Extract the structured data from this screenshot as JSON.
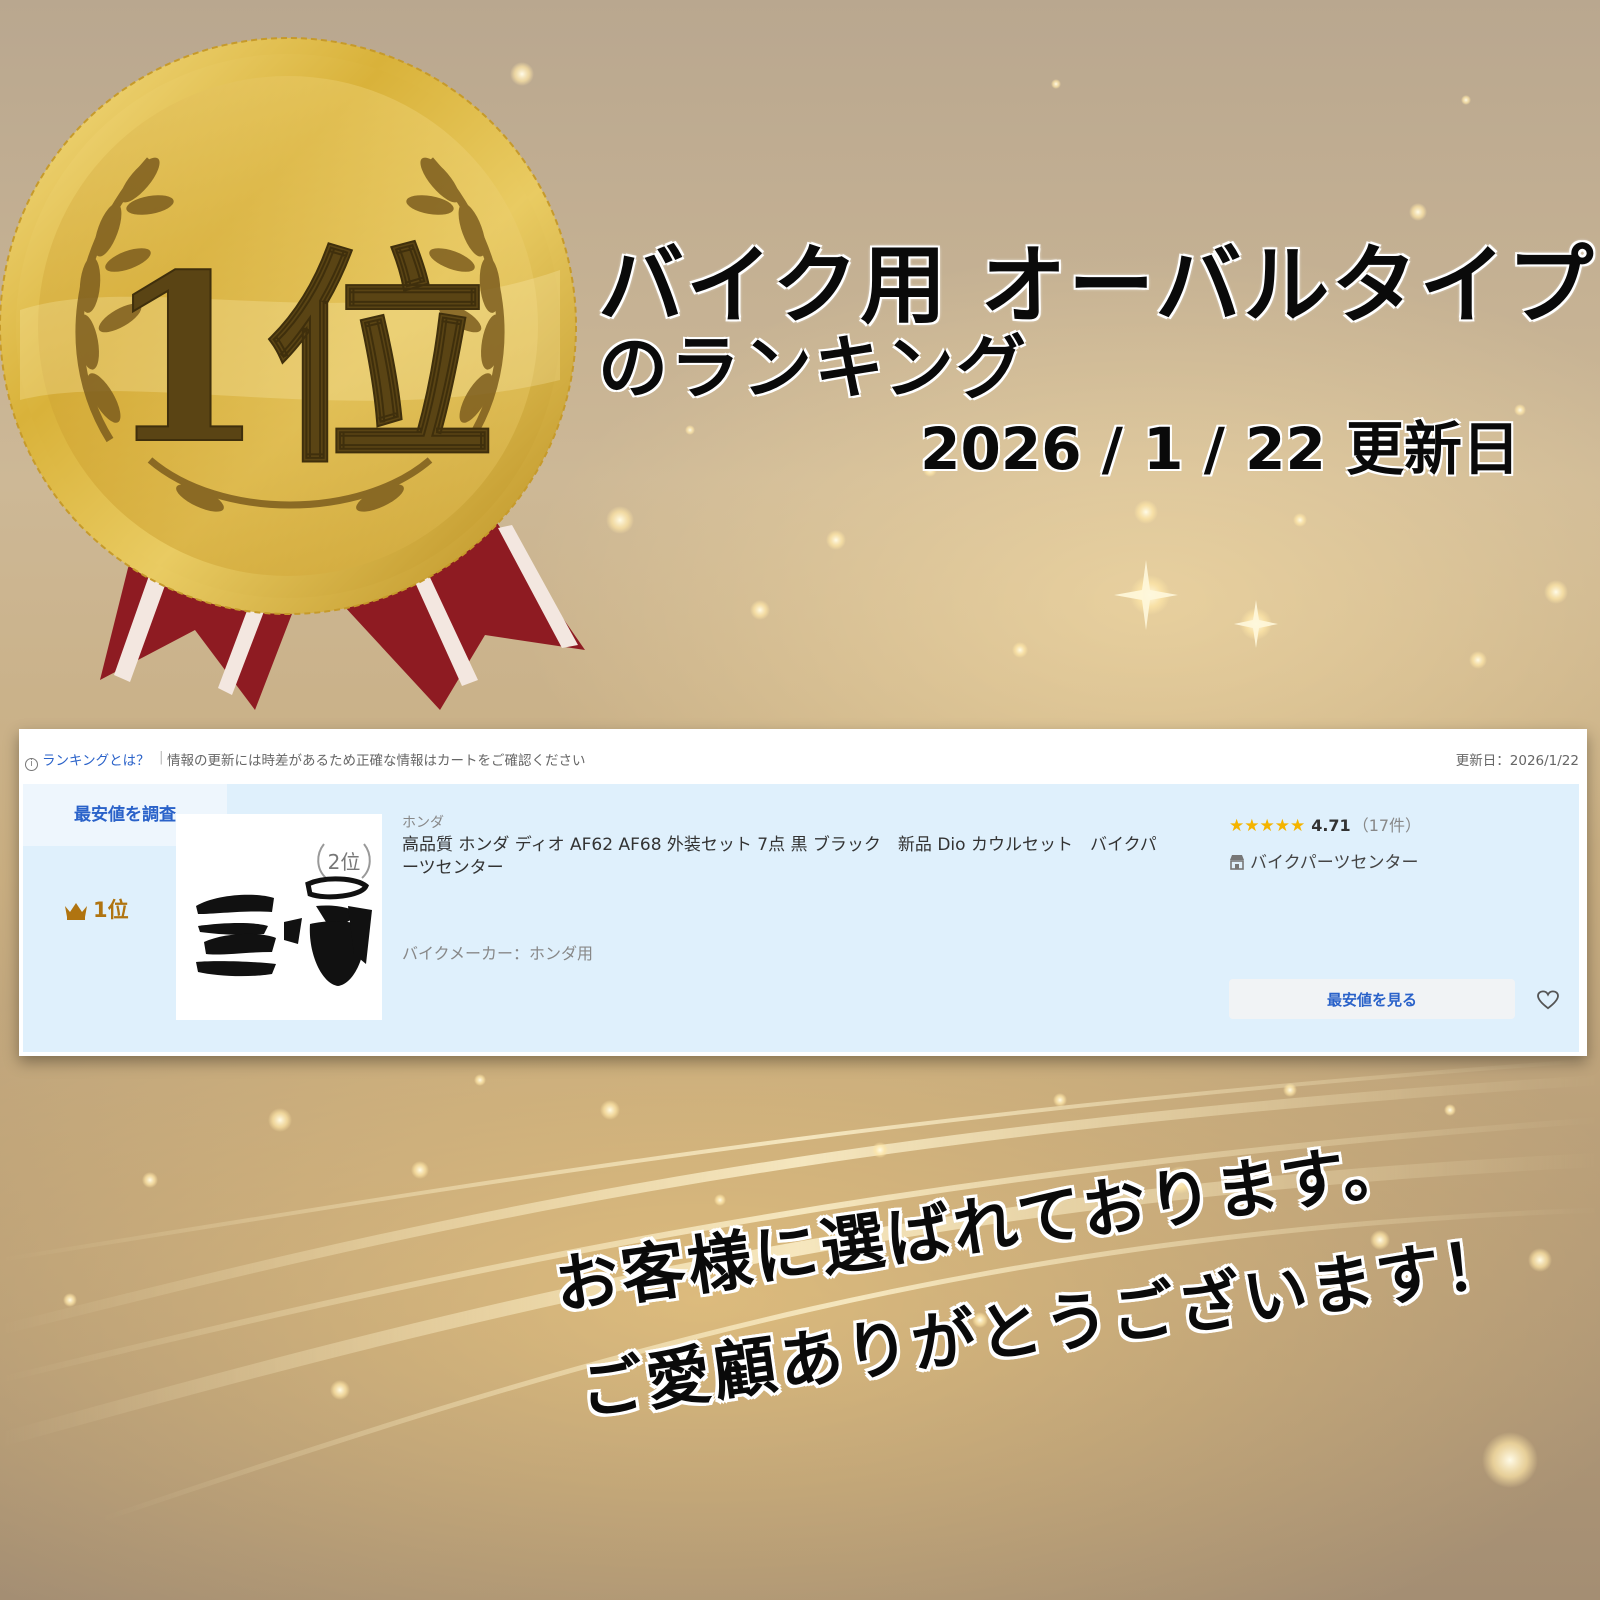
{
  "banner": {
    "headline": "バイク用 オーバルタイプ",
    "subline": "のランキング",
    "updated": "2026 / 1 / 22 更新日"
  },
  "medal": {
    "rank_text": "1位",
    "ribbon_color": "#8e1b22",
    "gold_color": "#d4a92c"
  },
  "panel": {
    "info_link": "ランキングとは？",
    "info_text": "情報の更新には時差があるため正確な情報はカートをご確認ください",
    "update_date": "更新日：2026/1/22",
    "lowest_tab": "最安値を調査",
    "rank": "1位",
    "product": {
      "maker": "ホンダ",
      "title": "高品質 ホンダ ディオ AF62 AF68 外装セット 7点 黒 ブラック　新品 Dio カウルセット　バイクパーツセンター",
      "spec": "バイクメーカー：ホンダ用",
      "image_badge": "2位",
      "stars_text": "★★★★★",
      "rating": "4.71",
      "review_count": "（17件）",
      "shop": "バイクパーツセンター",
      "cta_label": "最安値を見る"
    }
  },
  "message": {
    "line1": "お客様に選ばれております。",
    "line2": "ご愛顧ありがとうございます！"
  },
  "colors": {
    "link_blue": "#2a62c9",
    "row_bg": "#dff0fc",
    "rank_gold": "#b07410",
    "star": "#f4b400"
  }
}
